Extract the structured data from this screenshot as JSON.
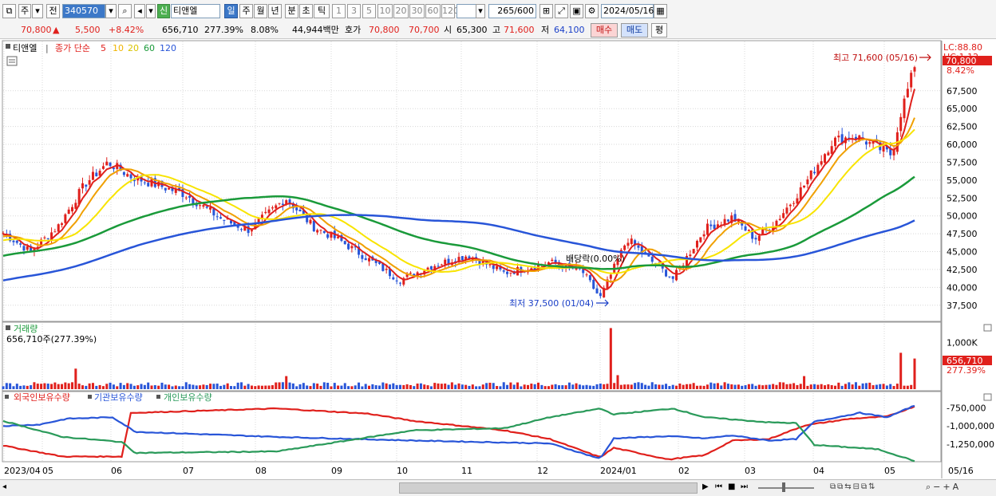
{
  "toolbar": {
    "mode1": "주",
    "mode2": "전",
    "code": "340570",
    "tag": "신",
    "name": "티앤엘",
    "periods": [
      "일",
      "주",
      "월",
      "년",
      "분",
      "초",
      "틱"
    ],
    "minutes": [
      "1",
      "3",
      "5",
      "10",
      "20",
      "30",
      "60",
      "120"
    ],
    "count": "265",
    "count_total": "/600",
    "date": "2024/05/16"
  },
  "info": {
    "price": "70,800",
    "arrow": "▲",
    "change": "5,500",
    "change_pct": "+8.42%",
    "volume": "656,710",
    "volume_pct": "277.39%",
    "turnover": "8.08%",
    "amount": "44,944백만",
    "quote_label": "호가",
    "ask": "70,800",
    "bid": "70,700",
    "open_label": "시",
    "open": "65,300",
    "high_label": "고",
    "high": "71,600",
    "low_label": "저",
    "low": "64,100",
    "buy": "매수",
    "sell": "매도",
    "eval": "평"
  },
  "legend": {
    "name": "티앤엘",
    "main_label": "종가 단순",
    "ma": [
      {
        "period": "5",
        "color": "#e0201c"
      },
      {
        "period": "10",
        "color": "#f0b400"
      },
      {
        "period": "20",
        "color": "#f0e000"
      },
      {
        "period": "60",
        "color": "#1a9a3a"
      },
      {
        "period": "120",
        "color": "#2855d8"
      }
    ]
  },
  "annotations": {
    "high": "최고 71,600 (05/16)",
    "low": "최저 37,500 (01/04)",
    "dividend": "배당락(0.00%)"
  },
  "right_axis": {
    "lc": "LC:88.80",
    "hc": "HC:1.12",
    "price_tag": "70,800",
    "pct_tag": "8.42%",
    "vol_tag": "656,710",
    "vol_pct_tag": "277.39%"
  },
  "volume_panel": {
    "title": "거래량",
    "value": "656,710주(277.39%)"
  },
  "holdings_panel": {
    "series": [
      {
        "name": "외국인보유수량",
        "color": "#e0201c"
      },
      {
        "name": "기관보유수량",
        "color": "#2855d8"
      },
      {
        "name": "개인보유수량",
        "color": "#2a9a5a"
      }
    ]
  },
  "chart_data": {
    "type": "line",
    "title": "",
    "price_axis": {
      "ylim": [
        35800,
        73500
      ],
      "ticks": [
        37500,
        40000,
        42500,
        45000,
        47500,
        50000,
        52500,
        55000,
        57500,
        60000,
        62500,
        65000,
        67500
      ]
    },
    "volume_axis": {
      "ylim": [
        0,
        1300000
      ],
      "ticks": [
        1000000
      ]
    },
    "holdings_axis": {
      "ylim": [
        -1480000,
        -680000
      ],
      "ticks": [
        -750000,
        -1000000,
        -1250000
      ]
    },
    "x_labels": [
      "2023/04",
      "05",
      "06",
      "07",
      "08",
      "09",
      "10",
      "11",
      "12",
      "2024/01",
      "02",
      "03",
      "04",
      "05",
      "05/16"
    ],
    "close_anchors": [
      {
        "t": 0,
        "v": 47600
      },
      {
        "t": 0.03,
        "v": 45000
      },
      {
        "t": 0.06,
        "v": 48500
      },
      {
        "t": 0.09,
        "v": 54500
      },
      {
        "t": 0.115,
        "v": 57500
      },
      {
        "t": 0.14,
        "v": 55500
      },
      {
        "t": 0.2,
        "v": 53000
      },
      {
        "t": 0.24,
        "v": 49500
      },
      {
        "t": 0.27,
        "v": 48000
      },
      {
        "t": 0.31,
        "v": 52500
      },
      {
        "t": 0.34,
        "v": 48500
      },
      {
        "t": 0.37,
        "v": 46500
      },
      {
        "t": 0.4,
        "v": 44000
      },
      {
        "t": 0.435,
        "v": 41000
      },
      {
        "t": 0.47,
        "v": 43000
      },
      {
        "t": 0.51,
        "v": 44500
      },
      {
        "t": 0.55,
        "v": 42000
      },
      {
        "t": 0.6,
        "v": 43500
      },
      {
        "t": 0.635,
        "v": 42300
      },
      {
        "t": 0.655,
        "v": 38500
      },
      {
        "t": 0.685,
        "v": 46800
      },
      {
        "t": 0.71,
        "v": 43800
      },
      {
        "t": 0.735,
        "v": 41200
      },
      {
        "t": 0.77,
        "v": 48200
      },
      {
        "t": 0.8,
        "v": 49800
      },
      {
        "t": 0.825,
        "v": 46800
      },
      {
        "t": 0.85,
        "v": 49500
      },
      {
        "t": 0.88,
        "v": 54500
      },
      {
        "t": 0.91,
        "v": 60500
      },
      {
        "t": 0.935,
        "v": 61200
      },
      {
        "t": 0.96,
        "v": 59500
      },
      {
        "t": 0.975,
        "v": 58500
      },
      {
        "t": 0.985,
        "v": 64500
      },
      {
        "t": 1,
        "v": 70800
      }
    ],
    "volume_spikes": [
      {
        "t": 0.08,
        "v": 440000
      },
      {
        "t": 0.31,
        "v": 280000
      },
      {
        "t": 0.665,
        "v": 1310000
      },
      {
        "t": 0.675,
        "v": 300000
      },
      {
        "t": 0.88,
        "v": 280000
      },
      {
        "t": 0.985,
        "v": 780000
      },
      {
        "t": 1,
        "v": 656710
      }
    ],
    "series": [
      {
        "name": "외국인보유수량",
        "anchors": [
          {
            "t": 0,
            "v": -1270000
          },
          {
            "t": 0.065,
            "v": -1420000
          },
          {
            "t": 0.13,
            "v": -1420000
          },
          {
            "t": 0.14,
            "v": -820000
          },
          {
            "t": 0.3,
            "v": -760000
          },
          {
            "t": 0.4,
            "v": -830000
          },
          {
            "t": 0.45,
            "v": -930000
          },
          {
            "t": 0.55,
            "v": -1060000
          },
          {
            "t": 0.6,
            "v": -1180000
          },
          {
            "t": 0.655,
            "v": -1430000
          },
          {
            "t": 0.67,
            "v": -1300000
          },
          {
            "t": 0.73,
            "v": -1460000
          },
          {
            "t": 0.77,
            "v": -1400000
          },
          {
            "t": 0.8,
            "v": -1200000
          },
          {
            "t": 0.84,
            "v": -1180000
          },
          {
            "t": 0.88,
            "v": -990000
          },
          {
            "t": 0.93,
            "v": -900000
          },
          {
            "t": 0.97,
            "v": -870000
          },
          {
            "t": 1,
            "v": -730000
          }
        ]
      },
      {
        "name": "기관보유수량",
        "anchors": [
          {
            "t": 0,
            "v": -1000000
          },
          {
            "t": 0.04,
            "v": -980000
          },
          {
            "t": 0.07,
            "v": -900000
          },
          {
            "t": 0.12,
            "v": -880000
          },
          {
            "t": 0.145,
            "v": -1080000
          },
          {
            "t": 0.3,
            "v": -1150000
          },
          {
            "t": 0.45,
            "v": -1200000
          },
          {
            "t": 0.6,
            "v": -1240000
          },
          {
            "t": 0.655,
            "v": -1450000
          },
          {
            "t": 0.67,
            "v": -1170000
          },
          {
            "t": 0.73,
            "v": -1140000
          },
          {
            "t": 0.77,
            "v": -1170000
          },
          {
            "t": 0.8,
            "v": -1130000
          },
          {
            "t": 0.84,
            "v": -1200000
          },
          {
            "t": 0.87,
            "v": -1180000
          },
          {
            "t": 0.89,
            "v": -940000
          },
          {
            "t": 0.94,
            "v": -820000
          },
          {
            "t": 0.97,
            "v": -880000
          },
          {
            "t": 1,
            "v": -720000
          }
        ]
      },
      {
        "name": "개인보유수량",
        "anchors": [
          {
            "t": 0,
            "v": -930000
          },
          {
            "t": 0.065,
            "v": -1150000
          },
          {
            "t": 0.13,
            "v": -1220000
          },
          {
            "t": 0.145,
            "v": -1370000
          },
          {
            "t": 0.3,
            "v": -1350000
          },
          {
            "t": 0.45,
            "v": -1060000
          },
          {
            "t": 0.55,
            "v": -1030000
          },
          {
            "t": 0.6,
            "v": -880000
          },
          {
            "t": 0.655,
            "v": -760000
          },
          {
            "t": 0.67,
            "v": -840000
          },
          {
            "t": 0.735,
            "v": -760000
          },
          {
            "t": 0.77,
            "v": -880000
          },
          {
            "t": 0.84,
            "v": -950000
          },
          {
            "t": 0.87,
            "v": -960000
          },
          {
            "t": 0.89,
            "v": -1260000
          },
          {
            "t": 0.96,
            "v": -1320000
          },
          {
            "t": 1,
            "v": -1480000
          }
        ]
      }
    ]
  }
}
